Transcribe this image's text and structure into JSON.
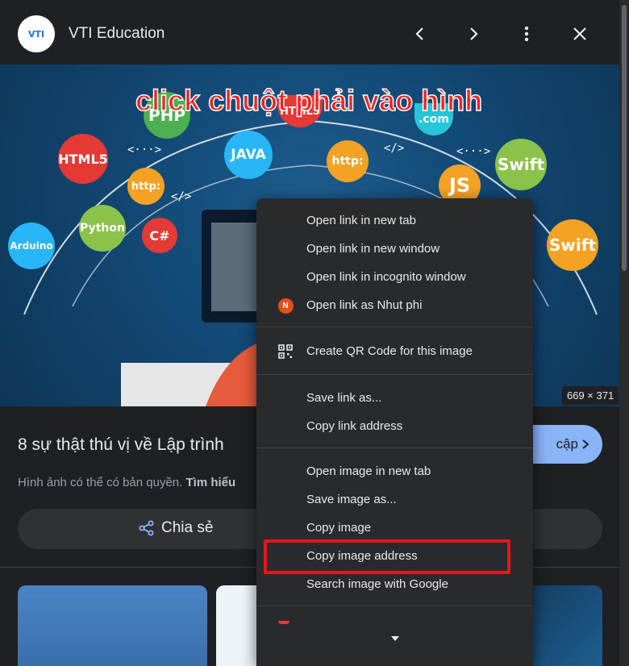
{
  "header": {
    "site_name": "VTI Education",
    "avatar_text": "VTI",
    "icons": [
      "chevron-left-icon",
      "chevron-right-icon",
      "more-vert-icon",
      "close-icon"
    ]
  },
  "hero": {
    "headline": "click chuột phải vào hình",
    "bubbles": [
      "PHP",
      "HTML5",
      "JAVA",
      "HTML5",
      ".com",
      "Swift",
      "http:",
      "JS",
      "Swift",
      "Arduino",
      "Python",
      "http:",
      "C#"
    ],
    "glyphs": [
      "<···>",
      "</>",
      "</>",
      "<···>",
      "</>"
    ],
    "dimensions": "669 × 371"
  },
  "result": {
    "title": "8 sự thật thú vị về Lập trình",
    "visit_label": "Truy cập",
    "visit_visible": "cập",
    "copyright_text": "Hình ảnh có thể có bản quyền.",
    "learn_more": "Tìm hiểu",
    "share_label": "Chia sẻ"
  },
  "context_menu": {
    "group1": [
      "Open link in new tab",
      "Open link in new window",
      "Open link in incognito window",
      "Open link as Nhut phi"
    ],
    "profile_initial": "N",
    "group2": [
      "Create QR Code for this image"
    ],
    "group3": [
      "Save link as...",
      "Copy link address"
    ],
    "group4": [
      "Open image in new tab",
      "Save image as...",
      "Copy image",
      "Copy image address",
      "Search image with Google"
    ],
    "highlighted_item": "Copy image address"
  },
  "colors": {
    "background": "#1f2023",
    "menu": "#292a2d",
    "accent": "#8ab4f8",
    "highlight_box": "#e8141b",
    "headline": "#ff1f1f"
  }
}
